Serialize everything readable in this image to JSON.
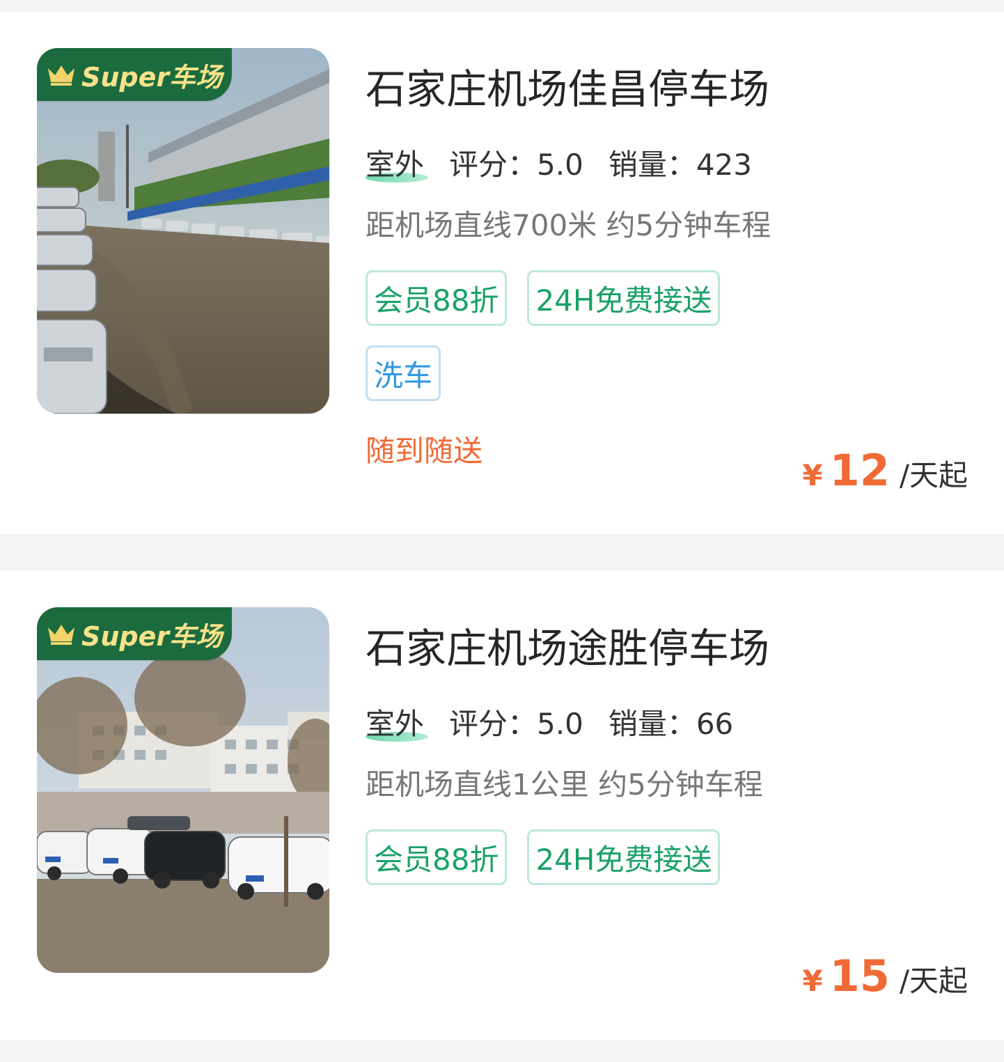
{
  "items": [
    {
      "badge": "Super车场",
      "title": "石家庄机场佳昌停车场",
      "type": "室外",
      "rating": "评分：5.0",
      "sales": "销量：423",
      "distance": "距机场直线700米 约5分钟车程",
      "tags": [
        "会员88折",
        "24H免费接送"
      ],
      "extra_tag": "洗车",
      "note": "随到随送",
      "price_symbol": "¥",
      "price": "12",
      "price_unit": "/天起"
    },
    {
      "badge": "Super车场",
      "title": "石家庄机场途胜停车场",
      "type": "室外",
      "rating": "评分：5.0",
      "sales": "销量：66",
      "distance": "距机场直线1公里 约5分钟车程",
      "tags": [
        "会员88折",
        "24H免费接送"
      ],
      "price_symbol": "¥",
      "price": "15",
      "price_unit": "/天起"
    }
  ],
  "colors": {
    "accent_green": "#1aa168",
    "accent_blue": "#2f98e0",
    "price_orange": "#f06a35",
    "badge_bg": "#1b6b3e",
    "badge_text": "#f7e28a"
  }
}
